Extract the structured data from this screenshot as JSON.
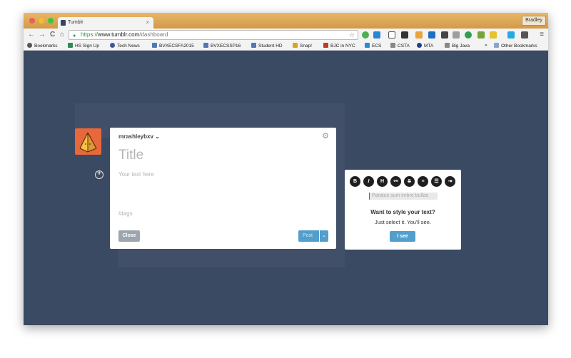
{
  "browser": {
    "tab_title": "Tumblr",
    "tab_close": "×",
    "user_name": "Bradley",
    "url": {
      "scheme": "https://",
      "host": "www.tumblr.com",
      "path": "/dashboard"
    },
    "nav": {
      "back": "←",
      "forward": "→",
      "reload": "C",
      "home": "⌂"
    },
    "star": "☆",
    "menu": "≡"
  },
  "bookmarks": {
    "items": [
      {
        "label": "Bookmarks",
        "color": "#555555"
      },
      {
        "label": "HS Sign Up",
        "color": "#2e8b57"
      },
      {
        "label": "Tech News",
        "color": "#3b5998"
      },
      {
        "label": "BVXECSFA2015",
        "color": "#4a7ab8"
      },
      {
        "label": "BVXECSSP16",
        "color": "#4a7ab8"
      },
      {
        "label": "Student HD",
        "color": "#4a7ab8"
      },
      {
        "label": "Snap!",
        "color": "#d9a520"
      },
      {
        "label": "BJC in NYC",
        "color": "#c0392b"
      },
      {
        "label": "ECS",
        "color": "#2a8bd0"
      },
      {
        "label": "CSTA",
        "color": "#888888"
      },
      {
        "label": "MTA",
        "color": "#1f3f8f"
      },
      {
        "label": "Big Java",
        "color": "#888888"
      }
    ],
    "more": "»",
    "other": "Other Bookmarks"
  },
  "composer": {
    "blog_name": "mrashleybxv",
    "blog_chevron": "⌄",
    "settings_icon": "⚙",
    "title_placeholder": "Title",
    "body_placeholder": "Your text here",
    "tags_placeholder": "#tags",
    "close_label": "Close",
    "post_label": "Post",
    "post_menu": "⌄"
  },
  "add_icon": "+",
  "tooltip": {
    "format_buttons": [
      "B",
      "I",
      "H",
      "⚯",
      "S",
      "≡",
      "☰",
      "⇥"
    ],
    "sample_text": "Paratus sum imbre bullae",
    "heading": "Want to style your text?",
    "body": "Just select it. You'll see.",
    "button_label": "I see"
  },
  "colors": {
    "dashboard_bg": "#36465d",
    "accent_blue": "#529ecc",
    "avatar_orange": "#e7683b"
  }
}
